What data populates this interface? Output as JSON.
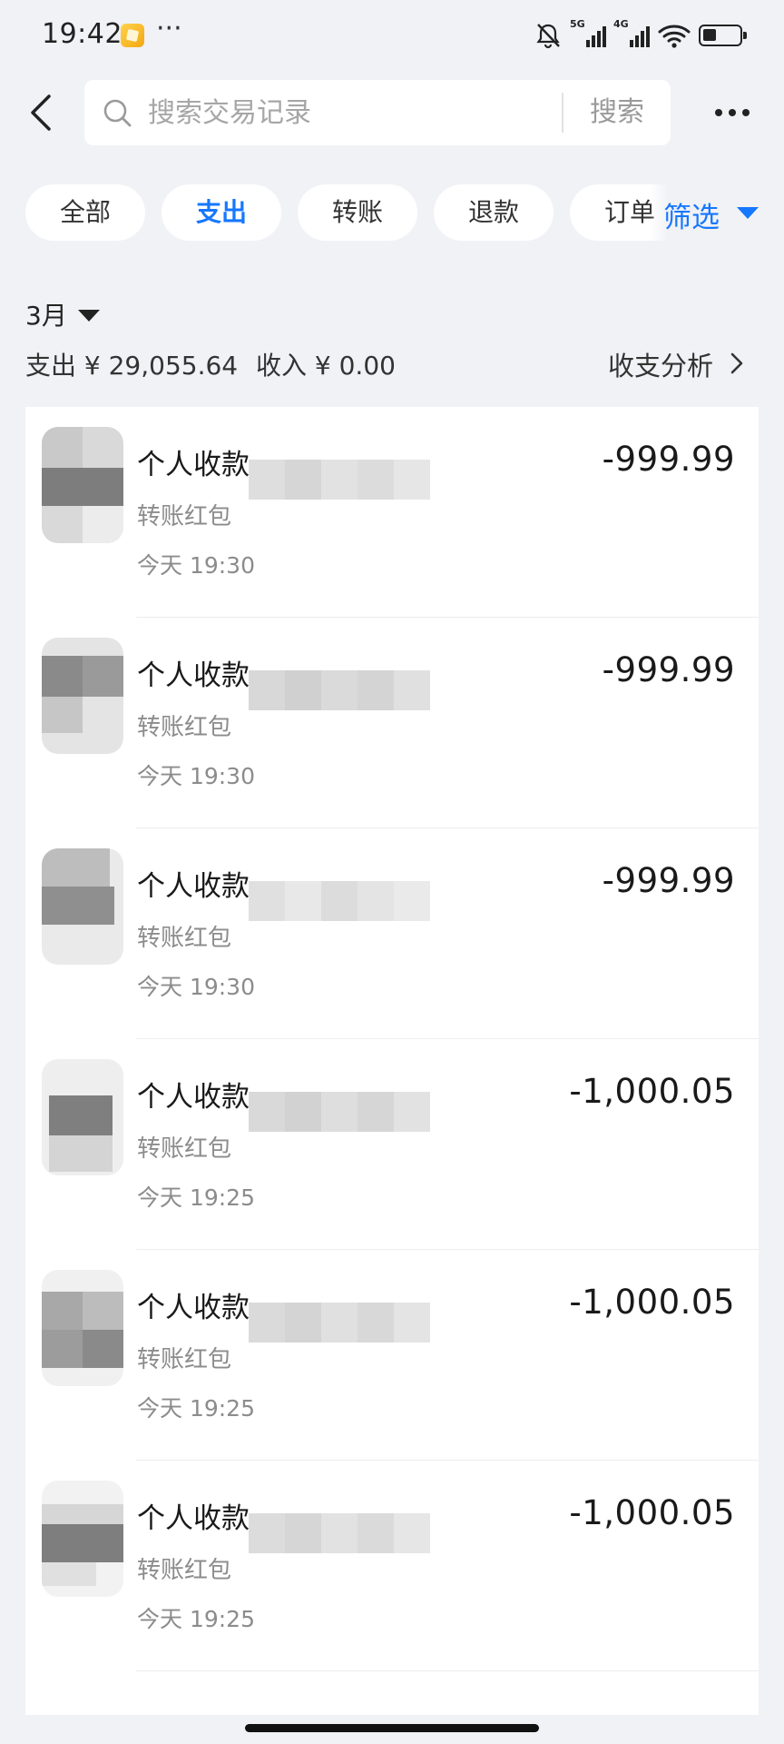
{
  "status_bar": {
    "time": "19:42",
    "more": "···",
    "signal_1": "5G",
    "signal_2": "4G",
    "icons": [
      "app-notification-icon",
      "bell-muted-icon",
      "signal-5g-icon",
      "signal-4g-icon",
      "wifi-icon",
      "battery-icon"
    ]
  },
  "search": {
    "placeholder": "搜索交易记录",
    "value": "",
    "button_label": "搜索"
  },
  "tabs": [
    {
      "label": "全部",
      "active": false
    },
    {
      "label": "支出",
      "active": true
    },
    {
      "label": "转账",
      "active": false
    },
    {
      "label": "退款",
      "active": false
    },
    {
      "label": "订单",
      "active": false
    }
  ],
  "filter": {
    "label": "筛选"
  },
  "summary": {
    "month": "3月",
    "expense": "支出 ¥ 29,055.64",
    "income": "收入 ¥ 0.00",
    "analysis_label": "收支分析"
  },
  "colors": {
    "accent": "#1677ff",
    "background": "#f0f2f5",
    "card": "#ffffff",
    "secondary_text": "#8c8c8c"
  },
  "transactions": [
    {
      "title": "个人收款",
      "subtitle": "转账红包",
      "time": "今天 19:30",
      "amount": "-999.99"
    },
    {
      "title": "个人收款-",
      "subtitle": "转账红包",
      "time": "今天 19:30",
      "amount": "-999.99"
    },
    {
      "title": "个人收款",
      "subtitle": "转账红包",
      "time": "今天 19:30",
      "amount": "-999.99"
    },
    {
      "title": "个人收款-",
      "subtitle": "转账红包",
      "time": "今天 19:25",
      "amount": "-1,000.05"
    },
    {
      "title": "个人收款-",
      "subtitle": "转账红包",
      "time": "今天 19:25",
      "amount": "-1,000.05"
    },
    {
      "title": "个人收款",
      "subtitle": "转账红包",
      "time": "今天 19:25",
      "amount": "-1,000.05"
    }
  ]
}
